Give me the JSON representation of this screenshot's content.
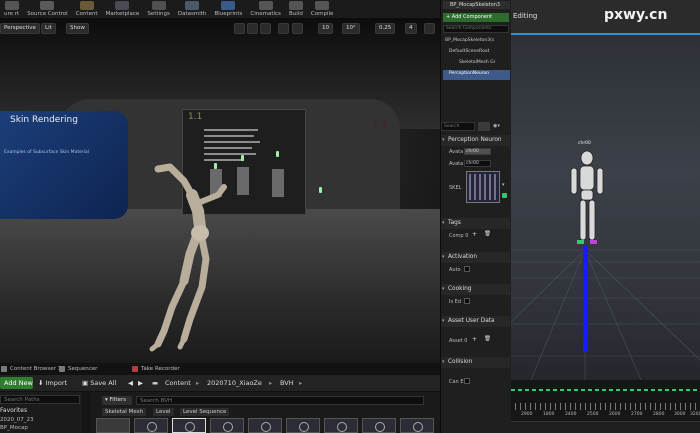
{
  "toolbar": {
    "items": [
      "ure rt",
      "Source Control",
      "Content",
      "Marketplace",
      "Settings",
      "Datasmith",
      "Blueprints",
      "Cinematics",
      "Build",
      "Compile"
    ]
  },
  "viewport": {
    "perspective": "Perspective",
    "lit": "Lit",
    "show": "Show",
    "grid_snap": "10",
    "rot_snap": "10°",
    "scale_snap": "0.25",
    "cam_speed": "4",
    "skin_title": "Skin Rendering",
    "skin_subtitle": "Examples of Subsurface Skin Material",
    "board_11": "1.1",
    "board_12": "1.2"
  },
  "content_browser": {
    "tabs": [
      "Content Browser 1",
      "Sequencer",
      "Take Recorder"
    ],
    "add_new": "Add New",
    "import": "Import",
    "save_all": "Save All",
    "path": [
      "Content",
      "2020710_XiaoZe",
      "BVH"
    ],
    "search_paths_placeholder": "Search Paths",
    "favorites": "Favorites",
    "fav_items": [
      "2020_07_23",
      "BP_Mocap"
    ],
    "filters": "Filters",
    "search_placeholder": "Search BVH",
    "filter_tags": [
      "Skeletal Mesh",
      "Level",
      "Level Sequence"
    ]
  },
  "details": {
    "window_tab": "BP_MocapSkeleton3",
    "add_component": "+ Add Component",
    "search_components": "Search Components",
    "tree": [
      "BP_MocapSkeleton3(s",
      "DefaultSceneRoot",
      "SkeletalMesh Gr",
      "PerceptionNeuron"
    ],
    "search": "Search",
    "sections": {
      "perception": "Perception Neuron",
      "tags": "Tags",
      "activation": "Activation",
      "cooking": "Cooking",
      "asset_user_data": "Asset User Data",
      "collision": "Collision"
    },
    "avatar_label": "Avata",
    "avatar_value": "chr00",
    "avatar2_label": "Avata",
    "avatar2_value": "chr00",
    "skeleton_label": "SKEL",
    "comp_label": "Comp",
    "comp_count": "0",
    "auto_label": "Auto",
    "is_ed_label": "Is Ed",
    "asset_label": "Asset",
    "asset_count": "0",
    "can_e_label": "Can E"
  },
  "persona": {
    "editing": "Editing",
    "watermark": "pxwy.cn",
    "char_label": "chr00",
    "timeline_numbers": [
      "2900",
      "1800",
      "2400",
      "2500",
      "2600",
      "2700",
      "2800",
      "3000",
      "3200"
    ]
  }
}
